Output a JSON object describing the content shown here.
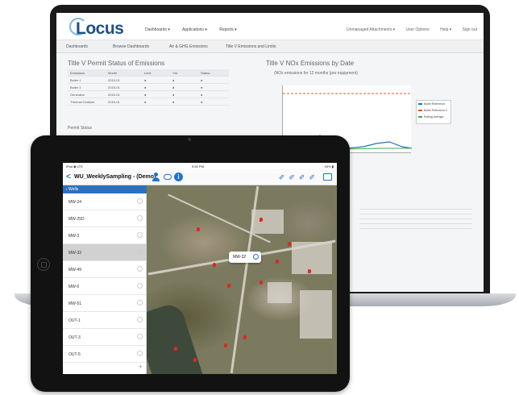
{
  "laptop": {
    "app": {
      "logo": "Locus",
      "menu": [
        "Dashboards ▾",
        "Applications ▾",
        "Reports ▾"
      ],
      "topright": [
        "Unmanaged Attachments ▾",
        "User Options",
        "Help ▾",
        "Sign out"
      ],
      "tabs": [
        "Dashboards",
        "Browse Dashboards",
        "Air & GHG Emissions",
        "Title V Emissions and Limits"
      ]
    },
    "left_panel": {
      "title": "Title V Permit Status of Emissions",
      "columns": [
        "Emissions",
        "Month",
        "Limit",
        "Ytd",
        "Status"
      ],
      "rows": [
        [
          "Boiler 1",
          "2015-01",
          "●",
          "●",
          "●"
        ],
        [
          "Boiler 2",
          "2015-01",
          "●",
          "●",
          "●"
        ],
        [
          "Generator",
          "2015-01",
          "●",
          "●",
          "●"
        ],
        [
          "Thermal Oxidizer",
          "2015-01",
          "●",
          "●",
          "●"
        ]
      ],
      "second_title": "Permit Status"
    },
    "chart": {
      "title": "Title V NOx Emissions by Date",
      "subtitle": "(NOx emissions for 12 months (per equipment)",
      "legend": [
        "Boiler Reference",
        "Boiler Reference 2",
        "Rolling Average"
      ],
      "colors": {
        "limit": "#e05a2b",
        "series1": "#2a6fbf",
        "series2": "#3fae49"
      }
    }
  },
  "tablet": {
    "status": {
      "left": "iPad ◉ LTE",
      "time": "9:50 PM",
      "right": "93% ▮"
    },
    "nav": {
      "back": "<",
      "title": "WU_WeeklySampling - (Demo)",
      "info": "i"
    },
    "sidebar": {
      "header": "‹ Wells",
      "items": [
        "MW-24",
        "MW-25D",
        "MW-3",
        "MW-32",
        "MW-49",
        "MW-6",
        "MW-51",
        "OUT-1",
        "OUT-3",
        "OUT-5"
      ],
      "selected": "MW-32",
      "add": "+"
    },
    "map": {
      "callout_label": "MW-32"
    }
  }
}
